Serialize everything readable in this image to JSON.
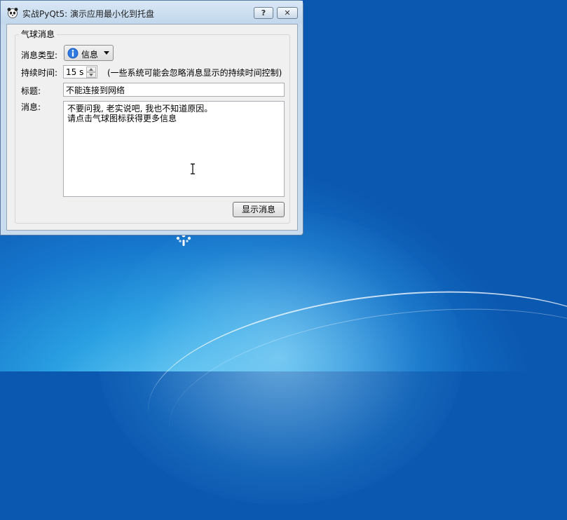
{
  "window": {
    "title": "实战PyQt5: 演示应用最小化到托盘",
    "help_button": "?",
    "close_button": "✕"
  },
  "group": {
    "title": "气球消息"
  },
  "form": {
    "type_label": "消息类型:",
    "type_value": "信息",
    "duration_label": "持续时间:",
    "duration_value": "15 s",
    "duration_note": "(一些系统可能会忽略消息显示的持续时间控制)",
    "title_label": "标题:",
    "title_value": "不能连接到网络",
    "message_label": "消息:",
    "message_lines": [
      "不要问我, 老实说吧, 我也不知道原因。",
      "请点击气球图标获得更多信息"
    ],
    "show_button": "显示消息"
  },
  "colors": {
    "desktop_blue": "#1677cc",
    "info_icon_blue": "#1c5fc4"
  },
  "icons": {
    "app": "panda-icon",
    "type": "info-icon",
    "cursor": "text-cursor-icon",
    "desktop_cursor": "busy-cursor-icon"
  }
}
